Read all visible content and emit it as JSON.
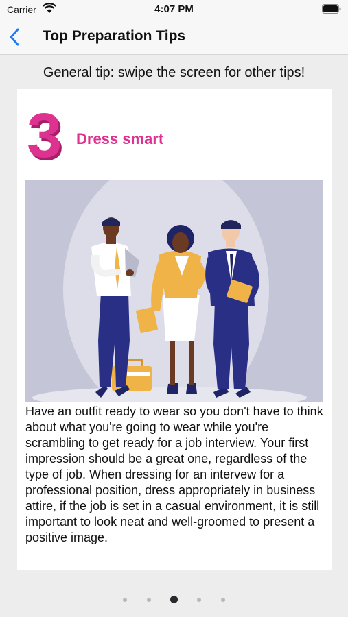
{
  "status_bar": {
    "carrier": "Carrier",
    "time": "4:07 PM"
  },
  "nav": {
    "title": "Top Preparation Tips",
    "back_icon": "chevron-left-icon",
    "accent_color": "#1e7cf0"
  },
  "general_tip": "General tip: swipe the screen for other tips!",
  "tip": {
    "number": "3",
    "title": "Dress smart",
    "color": "#de3290",
    "body": "Have an outfit ready to wear so you don't have to think about what you're going to wear while you're scrambling to get ready for a job interview. Your first impression should be a great one, regardless of the type of job. When dressing for an intervew for a professional position, dress appropriately in business attire, if the job is set in a casual environment, it is still important to look neat and well-groomed to present a positive image."
  },
  "pager": {
    "page_count": 5,
    "active_page": 3
  }
}
